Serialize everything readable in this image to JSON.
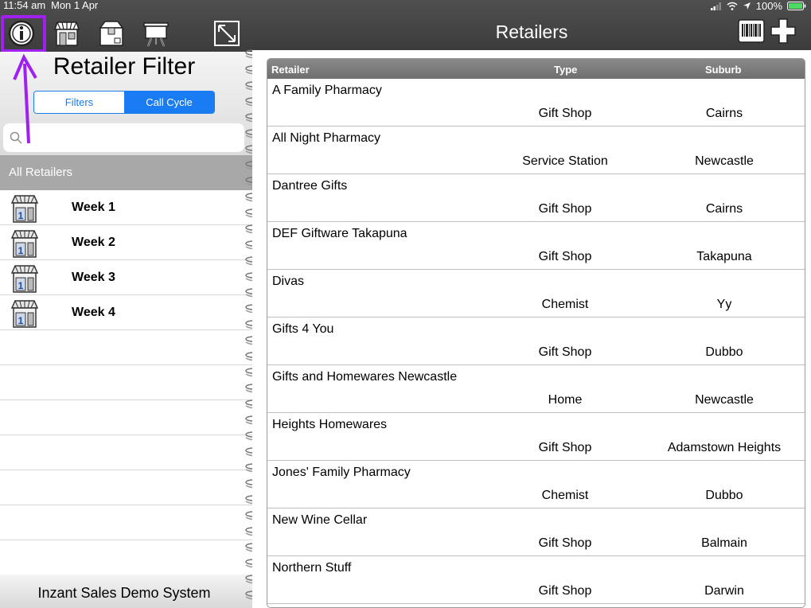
{
  "status_bar": {
    "time": "11:54 am",
    "date": "Mon 1 Apr",
    "battery": "100%"
  },
  "left_panel": {
    "toolbar_icons": [
      "info-icon",
      "store-icon",
      "box-icon",
      "easel-icon",
      "expand-icon"
    ],
    "title": "Retailer Filter",
    "segments": {
      "filters": "Filters",
      "call_cycle": "Call Cycle",
      "selected": "Call Cycle"
    },
    "search": {
      "placeholder": ""
    },
    "all_retailers": "All Retailers",
    "weeks": [
      {
        "label": "Week 1",
        "badge": "1"
      },
      {
        "label": "Week 2",
        "badge": "1"
      },
      {
        "label": "Week 3",
        "badge": "1"
      },
      {
        "label": "Week 4",
        "badge": "1"
      }
    ],
    "footer": "Inzant Sales Demo System"
  },
  "right_panel": {
    "title": "Retailers",
    "toolbar_icons": [
      "barcode-icon",
      "add-icon"
    ],
    "columns": {
      "retailer": "Retailer",
      "type": "Type",
      "suburb": "Suburb"
    },
    "retailers": [
      {
        "name": "A Family Pharmacy",
        "type": "Gift Shop",
        "suburb": "Cairns"
      },
      {
        "name": "All Night Pharmacy",
        "type": "Service Station",
        "suburb": "Newcastle"
      },
      {
        "name": "Dantree Gifts",
        "type": "Gift Shop",
        "suburb": "Cairns"
      },
      {
        "name": "DEF Giftware Takapuna",
        "type": "Gift Shop",
        "suburb": "Takapuna"
      },
      {
        "name": "Divas",
        "type": "Chemist",
        "suburb": "Yy"
      },
      {
        "name": "Gifts 4 You",
        "type": "Gift Shop",
        "suburb": "Dubbo"
      },
      {
        "name": "Gifts and Homewares Newcastle",
        "type": "Home",
        "suburb": "Newcastle"
      },
      {
        "name": "Heights Homewares",
        "type": "Gift Shop",
        "suburb": "Adamstown Heights"
      },
      {
        "name": "Jones' Family Pharmacy",
        "type": "Chemist",
        "suburb": "Dubbo"
      },
      {
        "name": "New Wine Cellar",
        "type": "Gift Shop",
        "suburb": "Balmain"
      },
      {
        "name": "Northern Stuff",
        "type": "Gift Shop",
        "suburb": "Darwin"
      }
    ]
  },
  "colors": {
    "accent": "#1a7cf2",
    "highlight": "#a020f0",
    "toolbar": "#444444",
    "battery": "#4cd964"
  }
}
